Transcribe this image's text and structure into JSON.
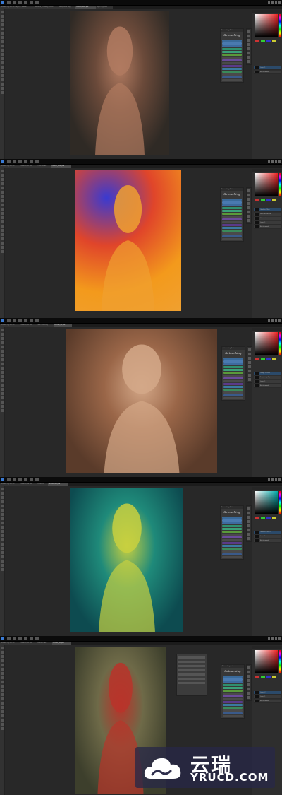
{
  "frames": [
    {
      "tabs": [
        "Untitled-1 @ 66.7% (Layer 1, RGB/8)",
        "Retouch_01.psd @ 33.3%",
        "Background copy",
        "Portrait_final.psd",
        "Layer 2 @ 25%"
      ],
      "active_tab": 3,
      "photo": {
        "subject": "woman in black lingerie, hands on hips",
        "colors": [
          "#2f2a25",
          "#6b4a3a",
          "#b07a60"
        ]
      },
      "actions_panel_title": "Retouching Actions",
      "logo_text": "Retouching",
      "layers": [
        "Layer 1",
        "Background"
      ],
      "swatch_colors": [
        "#c33",
        "#3c3",
        "#33c",
        "#cc3"
      ]
    },
    {
      "tabs": [
        "Untitled-1 @ 66.7%",
        "Retouch_02.psd",
        "Color Grade",
        "Portrait_neon.psd"
      ],
      "active_tab": 3,
      "photo": {
        "subject": "blonde woman with rainbow color effect",
        "colors": [
          "#3a3ad0",
          "#e0452a",
          "#f39a1c",
          "#f0a030"
        ]
      },
      "actions_panel_title": "Retouching Actions",
      "logo_text": "Retouching",
      "layers": [
        "Gradient Map",
        "Hue/Saturation",
        "Curves 1",
        "Layer 1",
        "Background"
      ],
      "swatch_colors": [
        "#c33",
        "#3c3",
        "#33c",
        "#cc3"
      ]
    },
    {
      "tabs": [
        "Untitled-1 @ 66.7%",
        "Retouch_03.psd",
        "Skin Softening",
        "Portrait_03.psd"
      ],
      "active_tab": 3,
      "photo": {
        "subject": "close-up portrait of woman with auburn hair",
        "colors": [
          "#5a3b2a",
          "#9a6648",
          "#d4a888"
        ]
      },
      "actions_panel_title": "Retouching Actions",
      "logo_text": "Retouching",
      "layers": [
        "Dodge & Burn",
        "Frequency Sep",
        "Layer 1",
        "Background"
      ],
      "swatch_colors": [
        "#c33",
        "#3c3",
        "#33c",
        "#cc3"
      ]
    },
    {
      "tabs": [
        "Untitled-1 @ 66.7%",
        "Retouch_04.psd",
        "Duotone",
        "Portrait_teal.psd"
      ],
      "active_tab": 3,
      "photo": {
        "subject": "woman in teal and yellow duotone",
        "colors": [
          "#0d4b50",
          "#1f8a7a",
          "#c8d040"
        ]
      },
      "actions_panel_title": "Retouching Actions",
      "logo_text": "Retouching",
      "layers": [
        "Gradient Map 1",
        "Layer 1",
        "Background"
      ],
      "swatch_colors": [
        "#c33",
        "#3c3",
        "#33c",
        "#cc3"
      ]
    },
    {
      "tabs": [
        "Untitled-1 @ 66.7%",
        "Retouch_05.psd",
        "Fashion Edit",
        "Portrait_red.psd"
      ],
      "active_tab": 3,
      "photo": {
        "subject": "woman in flowing red dress",
        "colors": [
          "#3d3f2c",
          "#6e6a48",
          "#b8342a"
        ]
      },
      "actions_panel_title": "Retouching Actions",
      "logo_text": "Retouching",
      "layers": [
        "Layer 2",
        "Layer 1",
        "Background"
      ],
      "swatch_colors": [
        "#c33",
        "#3c3",
        "#33c",
        "#cc3"
      ]
    }
  ],
  "action_button_colors": [
    "#3a6a9a",
    "#4a7ab0",
    "#3d6b9f",
    "#2f8f6f",
    "#3aa078",
    "#5a9a3a",
    "#4a4a4a",
    "#6a4a9a",
    "#4a4a4a",
    "#5a3a8a",
    "#3a7aa0",
    "#3a8a5a",
    "#4a4a4a",
    "#3a5a8a",
    "#4a4a4a"
  ],
  "watermark": {
    "chinese": "云瑞",
    "english": "YRUCD.COM",
    "icon": "cloud-icon"
  }
}
